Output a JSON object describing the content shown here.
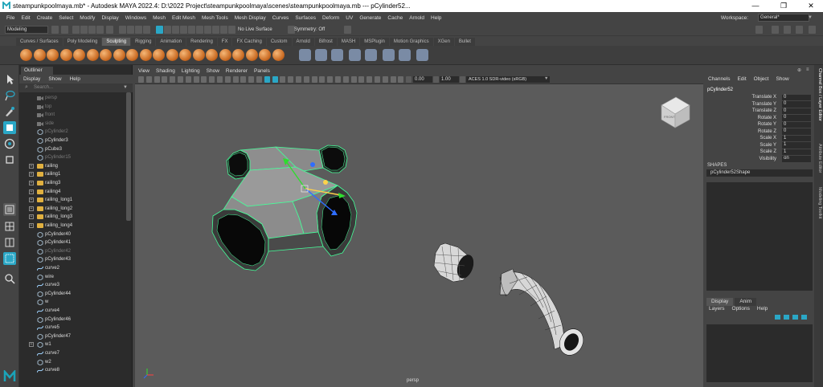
{
  "titlebar": {
    "title": "steampunkpoolmaya.mb* - Autodesk MAYA 2022.4: D:\\2022 Project\\steampunkpoolmaya\\scenes\\steampunkpoolmaya.mb   ---   pCylinder52...",
    "minimize": "—",
    "restore": "❐",
    "close": "✕"
  },
  "menubar": {
    "items": [
      "File",
      "Edit",
      "Create",
      "Select",
      "Modify",
      "Display",
      "Windows",
      "Mesh",
      "Edit Mesh",
      "Mesh Tools",
      "Mesh Display",
      "Curves",
      "Surfaces",
      "Deform",
      "UV",
      "Generate",
      "Cache",
      "Arnold",
      "Help"
    ],
    "workspace_label": "Workspace:",
    "workspace_value": "General*"
  },
  "statusline": {
    "mode": "Modeling",
    "live_surface": "No Live Surface",
    "symmetry": "Symmetry: Off"
  },
  "shelf": {
    "tabs": [
      "Curves / Surfaces",
      "Poly Modeling",
      "Sculpting",
      "Rigging",
      "Animation",
      "Rendering",
      "FX",
      "FX Caching",
      "Custom",
      "Arnold",
      "Bifrost",
      "MASH",
      "MSPlugin",
      "Motion Graphics",
      "XGen",
      "Bullet"
    ],
    "active_tab": "Sculpting"
  },
  "outliner": {
    "tab": "Outliner",
    "menu": [
      "Display",
      "Show",
      "Help"
    ],
    "search_placeholder": "Search...",
    "items": [
      {
        "label": "persp",
        "dim": true,
        "type": "camera",
        "expand": false
      },
      {
        "label": "top",
        "dim": true,
        "type": "camera",
        "expand": false
      },
      {
        "label": "front",
        "dim": true,
        "type": "camera",
        "expand": false
      },
      {
        "label": "side",
        "dim": true,
        "type": "camera",
        "expand": false
      },
      {
        "label": "pCylinder2",
        "dim": true,
        "type": "mesh",
        "expand": false
      },
      {
        "label": "pCylinder3",
        "dim": false,
        "type": "mesh",
        "expand": false
      },
      {
        "label": "pCube3",
        "dim": false,
        "type": "mesh",
        "expand": false
      },
      {
        "label": "pCylinder15",
        "dim": true,
        "type": "mesh",
        "expand": false
      },
      {
        "label": "railing",
        "dim": false,
        "type": "group",
        "expand": true
      },
      {
        "label": "railing1",
        "dim": false,
        "type": "group",
        "expand": true
      },
      {
        "label": "railing3",
        "dim": false,
        "type": "group",
        "expand": true
      },
      {
        "label": "railing4",
        "dim": false,
        "type": "group",
        "expand": true
      },
      {
        "label": "railing_long1",
        "dim": false,
        "type": "group",
        "expand": true
      },
      {
        "label": "railing_long2",
        "dim": false,
        "type": "group",
        "expand": true
      },
      {
        "label": "railing_long3",
        "dim": false,
        "type": "group",
        "expand": true
      },
      {
        "label": "railing_long4",
        "dim": false,
        "type": "group",
        "expand": true
      },
      {
        "label": "pCylinder40",
        "dim": false,
        "type": "mesh",
        "expand": false
      },
      {
        "label": "pCylinder41",
        "dim": false,
        "type": "mesh",
        "expand": false
      },
      {
        "label": "pCylinder42",
        "dim": true,
        "type": "mesh",
        "expand": false
      },
      {
        "label": "pCylinder43",
        "dim": false,
        "type": "mesh",
        "expand": false
      },
      {
        "label": "curve2",
        "dim": false,
        "type": "curve",
        "expand": false
      },
      {
        "label": "wire",
        "dim": false,
        "type": "mesh",
        "expand": false
      },
      {
        "label": "curve3",
        "dim": false,
        "type": "curve",
        "expand": false
      },
      {
        "label": "pCylinder44",
        "dim": false,
        "type": "mesh",
        "expand": false
      },
      {
        "label": "w",
        "dim": false,
        "type": "mesh",
        "expand": false
      },
      {
        "label": "curve4",
        "dim": false,
        "type": "curve",
        "expand": false
      },
      {
        "label": "pCylinder46",
        "dim": false,
        "type": "mesh",
        "expand": false
      },
      {
        "label": "curve5",
        "dim": false,
        "type": "curve",
        "expand": false
      },
      {
        "label": "pCylinder47",
        "dim": false,
        "type": "mesh",
        "expand": false
      },
      {
        "label": "w1",
        "dim": false,
        "type": "mesh",
        "expand": true
      },
      {
        "label": "curve7",
        "dim": false,
        "type": "curve",
        "expand": false
      },
      {
        "label": "w2",
        "dim": false,
        "type": "mesh",
        "expand": false
      },
      {
        "label": "curve8",
        "dim": false,
        "type": "curve",
        "expand": false
      }
    ]
  },
  "viewport": {
    "menu": [
      "View",
      "Shading",
      "Lighting",
      "Show",
      "Renderer",
      "Panels"
    ],
    "exposure": "0.00",
    "gamma": "1.00",
    "color_space": "ACES 1.0 SDR-video (sRGB)",
    "camera_label": "persp",
    "viewcube_label": "FRONT"
  },
  "channelbox": {
    "menu": [
      "Channels",
      "Edit",
      "Object",
      "Show"
    ],
    "object": "pCylinder52",
    "attributes": [
      {
        "name": "Translate X",
        "value": "0"
      },
      {
        "name": "Translate Y",
        "value": "0"
      },
      {
        "name": "Translate Z",
        "value": "0"
      },
      {
        "name": "Rotate X",
        "value": "0"
      },
      {
        "name": "Rotate Y",
        "value": "0"
      },
      {
        "name": "Rotate Z",
        "value": "0"
      },
      {
        "name": "Scale X",
        "value": "1"
      },
      {
        "name": "Scale Y",
        "value": "1"
      },
      {
        "name": "Scale Z",
        "value": "1"
      },
      {
        "name": "Visibility",
        "value": "on"
      }
    ],
    "shapes_header": "SHAPES",
    "shape": "pCylinder52Shape",
    "layer_tabs": [
      "Display",
      "Anim"
    ],
    "layer_menu": [
      "Layers",
      "Options",
      "Help"
    ]
  },
  "side_tabs": [
    "Channel Box / Layer Editor",
    "Attribute Editor",
    "Modeling Toolkit"
  ],
  "colors": {
    "accent": "#2aa7c6",
    "selection_wire": "#44ff99",
    "viewport_bg": "#5b5b5b"
  }
}
